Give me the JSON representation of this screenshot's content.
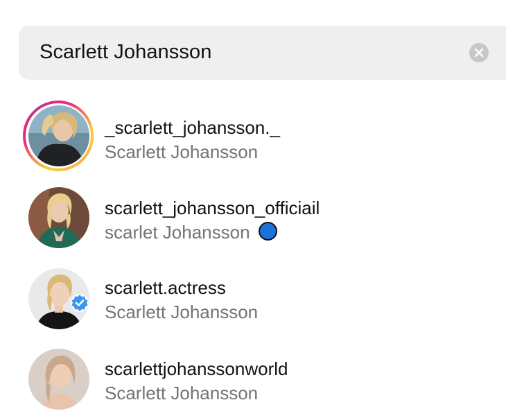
{
  "search": {
    "query": "Scarlett Johansson",
    "clear_icon": "clear-circle-icon"
  },
  "results": [
    {
      "username": "_scarlett_johansson._",
      "full_name": "Scarlett Johansson",
      "has_story_ring": true,
      "verified": false
    },
    {
      "username": "scarlett_johansson_officiail",
      "full_name": "scarlet Johansson",
      "has_story_ring": false,
      "marker": "blue-circle-icon"
    },
    {
      "username": "scarlett.actress",
      "full_name": "Scarlett Johansson",
      "has_story_ring": false,
      "verified": true
    },
    {
      "username": "scarlettjohanssonworld",
      "full_name": "Scarlett Johansson",
      "has_story_ring": false,
      "verified": false
    }
  ],
  "colors": {
    "search_bg": "#efefef",
    "secondary_text": "#737373",
    "blue_marker": "#1a73d9",
    "verified_blue": "#3897f0"
  }
}
